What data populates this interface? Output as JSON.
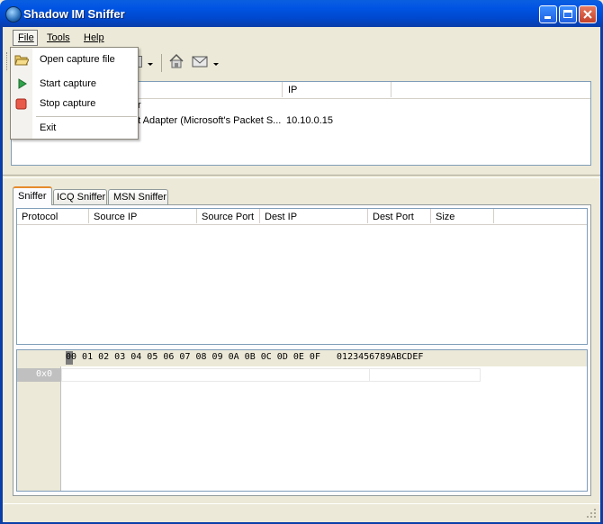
{
  "window": {
    "title": "Shadow IM Sniffer"
  },
  "menubar": {
    "file": "File",
    "tools": "Tools",
    "help": "Help"
  },
  "file_menu": {
    "items": [
      {
        "label": "Open capture file",
        "icon": "folder-open-icon"
      },
      {
        "label": "Start capture",
        "icon": "play-icon"
      },
      {
        "label": "Stop capture",
        "icon": "stop-icon"
      },
      {
        "label": "Exit"
      }
    ]
  },
  "adapters": {
    "columns": [
      "IP"
    ],
    "rows": [
      {
        "name_visible": "r",
        "ip": ""
      },
      {
        "name_visible": "et Adapter (Microsoft's Packet S...",
        "ip": "10.10.0.15"
      }
    ]
  },
  "tabs": [
    "Sniffer",
    "ICQ Sniffer",
    "MSN Sniffer"
  ],
  "packets": {
    "columns": [
      "Protocol",
      "Source IP",
      "Source Port",
      "Dest IP",
      "Dest Port",
      "Size"
    ],
    "rows": []
  },
  "hex_view": {
    "header": "00 01 02 03 04 05 06 07 08 09 0A 0B 0C 0D 0E 0F   0123456789ABCDEF",
    "offset": "0x0"
  },
  "colors": {
    "titlebar": "#0054e3",
    "selected_tab_accent": "#e68b2c"
  }
}
